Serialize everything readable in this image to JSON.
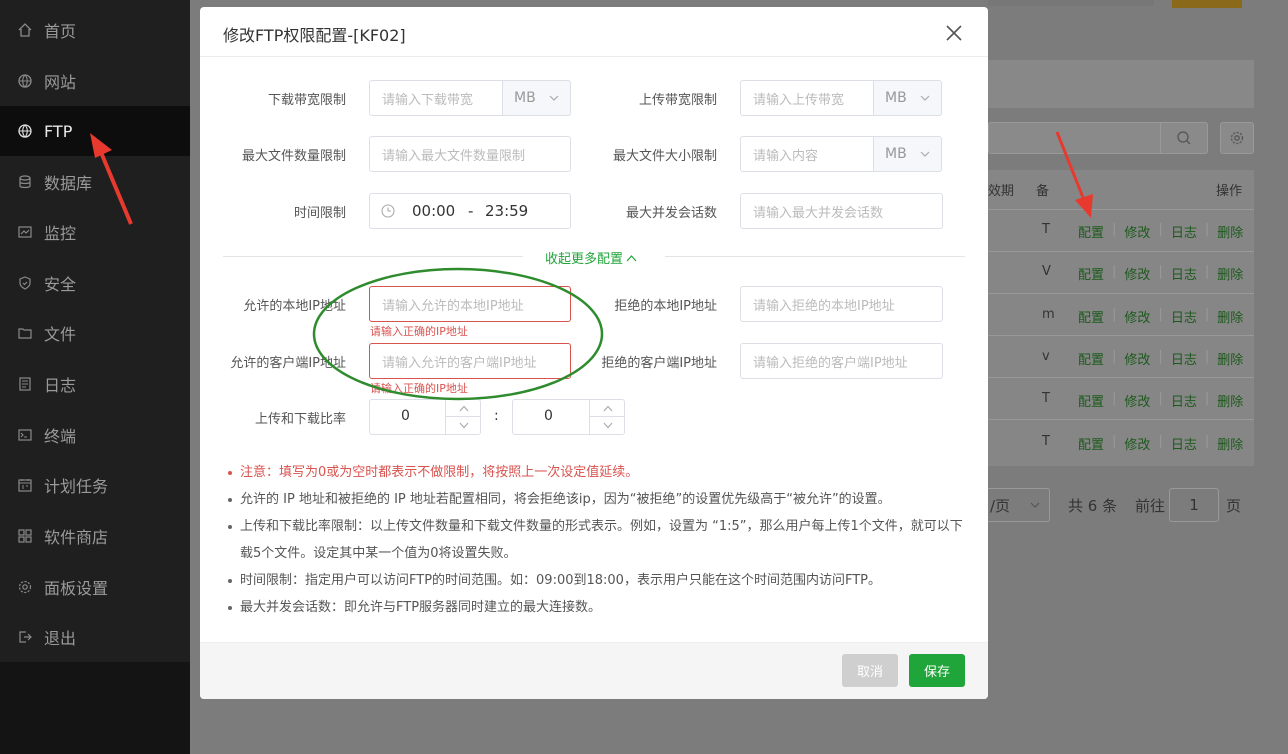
{
  "sidebar": {
    "items": [
      {
        "label": "首页",
        "icon": "home-icon"
      },
      {
        "label": "网站",
        "icon": "globe-icon"
      },
      {
        "label": "FTP",
        "icon": "globe-icon",
        "active": true
      },
      {
        "label": "数据库",
        "icon": "database-icon"
      },
      {
        "label": "监控",
        "icon": "monitor-icon"
      },
      {
        "label": "安全",
        "icon": "shield-icon"
      },
      {
        "label": "文件",
        "icon": "folder-icon"
      },
      {
        "label": "日志",
        "icon": "log-icon"
      },
      {
        "label": "终端",
        "icon": "terminal-icon"
      },
      {
        "label": "计划任务",
        "icon": "calendar-icon"
      },
      {
        "label": "软件商店",
        "icon": "apps-icon"
      },
      {
        "label": "面板设置",
        "icon": "gear-icon"
      },
      {
        "label": "退出",
        "icon": "logout-icon"
      }
    ]
  },
  "background": {
    "table_headers": {
      "expire": "效期",
      "note": "备",
      "actions": "操作"
    },
    "rows": [
      {
        "letter": "T"
      },
      {
        "letter": "V"
      },
      {
        "letter": "m"
      },
      {
        "letter": "v"
      },
      {
        "letter": "T"
      },
      {
        "letter": "T"
      }
    ],
    "action_labels": {
      "config": "配置",
      "edit": "修改",
      "log": "日志",
      "delete": "删除"
    },
    "pager": {
      "per_page": "/页",
      "total": "共 6 条",
      "goto": "前往",
      "page": "1",
      "page_suffix": "页"
    }
  },
  "modal": {
    "title": "修改FTP权限配置-[KF02]",
    "fields": {
      "download_bw": {
        "label": "下载带宽限制",
        "placeholder": "请输入下载带宽",
        "unit": "MB"
      },
      "upload_bw": {
        "label": "上传带宽限制",
        "placeholder": "请输入上传带宽",
        "unit": "MB"
      },
      "max_files": {
        "label": "最大文件数量限制",
        "placeholder": "请输入最大文件数量限制"
      },
      "max_file_size": {
        "label": "最大文件大小限制",
        "placeholder": "请输入内容",
        "unit": "MB"
      },
      "time_limit": {
        "label": "时间限制",
        "start": "00:00",
        "sep": "-",
        "end": "23:59"
      },
      "max_sessions": {
        "label": "最大并发会话数",
        "placeholder": "请输入最大并发会话数"
      },
      "allow_local_ip": {
        "label": "允许的本地IP地址",
        "placeholder": "请输入允许的本地IP地址",
        "error": "请输入正确的IP地址"
      },
      "deny_local_ip": {
        "label": "拒绝的本地IP地址",
        "placeholder": "请输入拒绝的本地IP地址"
      },
      "allow_client_ip": {
        "label": "允许的客户端IP地址",
        "placeholder": "请输入允许的客户端IP地址",
        "error": "请输入正确的IP地址"
      },
      "deny_client_ip": {
        "label": "拒绝的客户端IP地址",
        "placeholder": "请输入拒绝的客户端IP地址"
      },
      "ratio": {
        "label": "上传和下载比率",
        "upload": "0",
        "colon": ":",
        "download": "0"
      }
    },
    "collapse_label": "收起更多配置",
    "notes": [
      {
        "text": "注意：填写为0或为空时都表示不做限制，将按照上一次设定值延续。",
        "red": true
      },
      {
        "text": "允许的 IP 地址和被拒绝的 IP 地址若配置相同，将会拒绝该ip，因为“被拒绝”的设置优先级高于“被允许”的设置。"
      },
      {
        "text": "上传和下载比率限制：以上传文件数量和下载文件数量的形式表示。例如，设置为 “1:5”，那么用户每上传1个文件，就可以下载5个文件。设定其中某一个值为0将设置失败。"
      },
      {
        "text": "时间限制：指定用户可以访问FTP的时间范围。如：09:00到18:00，表示用户只能在这个时间范围内访问FTP。"
      },
      {
        "text": "最大并发会话数：即允许与FTP服务器同时建立的最大连接数。"
      }
    ],
    "buttons": {
      "cancel": "取消",
      "save": "保存"
    }
  },
  "colors": {
    "accent": "#20a53a",
    "error": "#d9534f",
    "annotation_red": "#e8392f",
    "annotation_green": "#2e8b2e"
  }
}
